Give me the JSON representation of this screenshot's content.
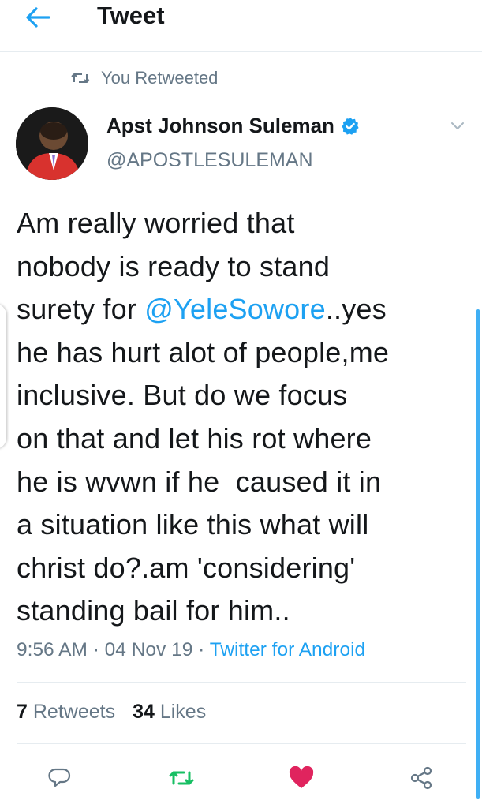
{
  "header": {
    "title": "Tweet"
  },
  "retweet_notice": "You Retweeted",
  "author": {
    "name": "Apst Johnson Suleman",
    "handle": "@APOSTLESULEMAN"
  },
  "tweet": {
    "line1": "Am really worried that",
    "line2": "nobody is ready to stand",
    "line3_pre": "surety for ",
    "mention": "@YeleSowore",
    "line3_post": "..yes",
    "line4": "he has hurt alot of people,me",
    "line5": "inclusive. But do we focus",
    "line6": "on that and let his rot where",
    "line7": "he is wvwn if he  caused it in",
    "line8": "a situation like this what will",
    "line9": "christ do?.am 'considering'",
    "line10": "standing bail for him.."
  },
  "meta": {
    "time": "9:56 AM",
    "sep1": " · ",
    "date": "04 Nov 19",
    "sep2": " · ",
    "source": "Twitter for Android"
  },
  "stats": {
    "retweets_count": "7",
    "retweets_label": "Retweets",
    "likes_count": "34",
    "likes_label": "Likes"
  },
  "icons": {
    "back": "arrow-left-icon",
    "retweet": "retweet-icon",
    "verified": "verified-badge-icon",
    "caret": "chevron-down-icon",
    "reply": "reply-icon",
    "like": "heart-icon",
    "share": "share-icon"
  },
  "colors": {
    "accent": "#1da1f2",
    "retweet_active": "#17bf63",
    "like_active": "#e0245e",
    "muted": "#657786"
  }
}
